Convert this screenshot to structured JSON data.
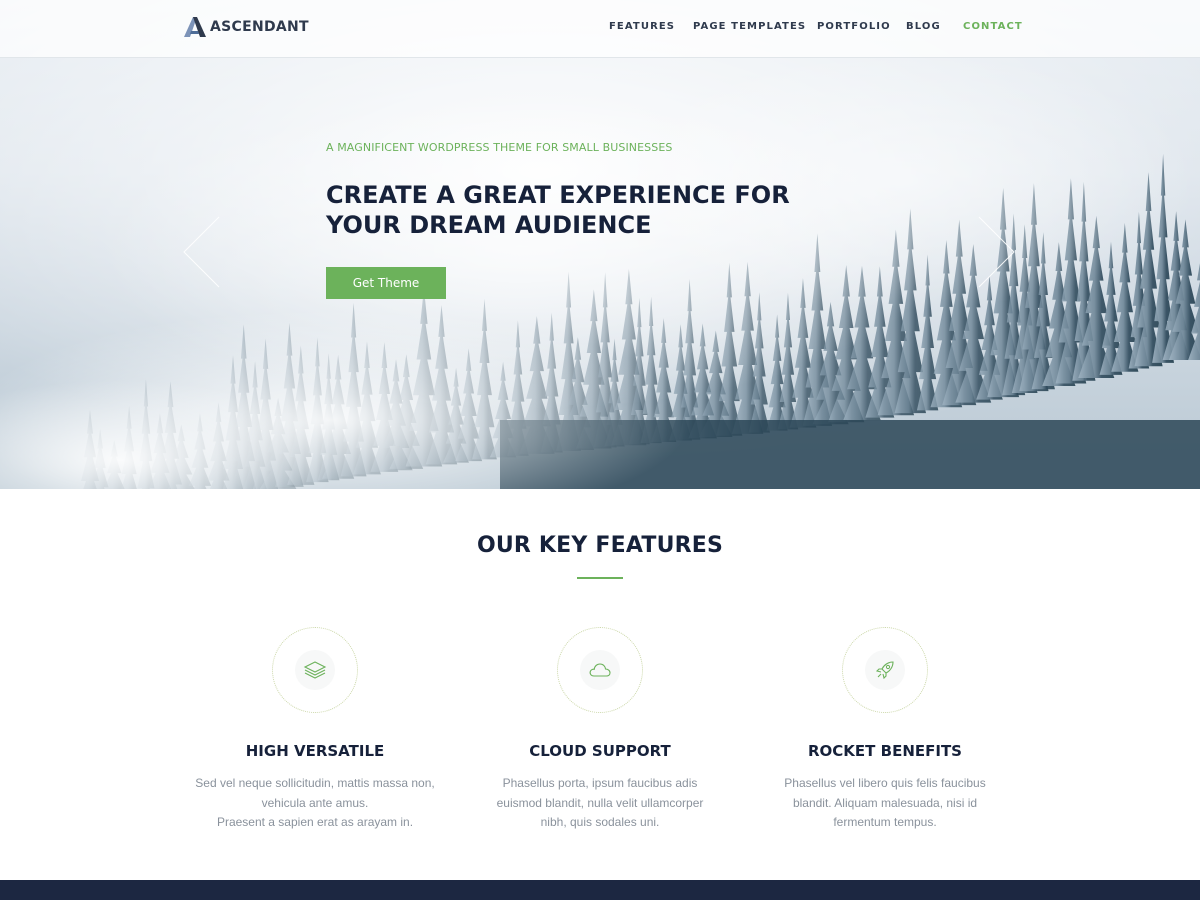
{
  "brand": {
    "name": "ASCENDANT",
    "accent": "#6cb25b",
    "dark": "#16213a"
  },
  "nav": {
    "items": [
      {
        "label": "FEATURES",
        "active": false
      },
      {
        "label": "PAGE TEMPLATES",
        "active": false
      },
      {
        "label": "PORTFOLIO",
        "active": false
      },
      {
        "label": "BLOG",
        "active": false
      },
      {
        "label": "CONTACT",
        "active": true
      }
    ]
  },
  "hero": {
    "eyebrow": "A MAGNIFICENT WORDPRESS THEME FOR SMALL BUSINESSES",
    "headline_line1": "CREATE A GREAT EXPERIENCE FOR",
    "headline_line2": "YOUR DREAM AUDIENCE",
    "cta_label": "Get Theme",
    "prev_icon": "chevron-left-icon",
    "next_icon": "chevron-right-icon"
  },
  "features": {
    "title": "OUR KEY FEATURES",
    "items": [
      {
        "icon": "layers-icon",
        "title": "HIGH VERSATILE",
        "lines": [
          "Sed vel neque sollicitudin, mattis massa non,",
          "vehicula ante amus.",
          "Praesent a sapien erat as arayam in."
        ]
      },
      {
        "icon": "cloud-icon",
        "title": "CLOUD SUPPORT",
        "lines": [
          "Phasellus porta, ipsum faucibus adis",
          "euismod blandit, nulla velit ullamcorper",
          "nibh, quis sodales uni."
        ]
      },
      {
        "icon": "rocket-icon",
        "title": "ROCKET BENEFITS",
        "lines": [
          "Phasellus vel libero quis felis faucibus",
          "blandit. Aliquam malesuada, nisi id",
          "fermentum tempus."
        ]
      }
    ]
  }
}
